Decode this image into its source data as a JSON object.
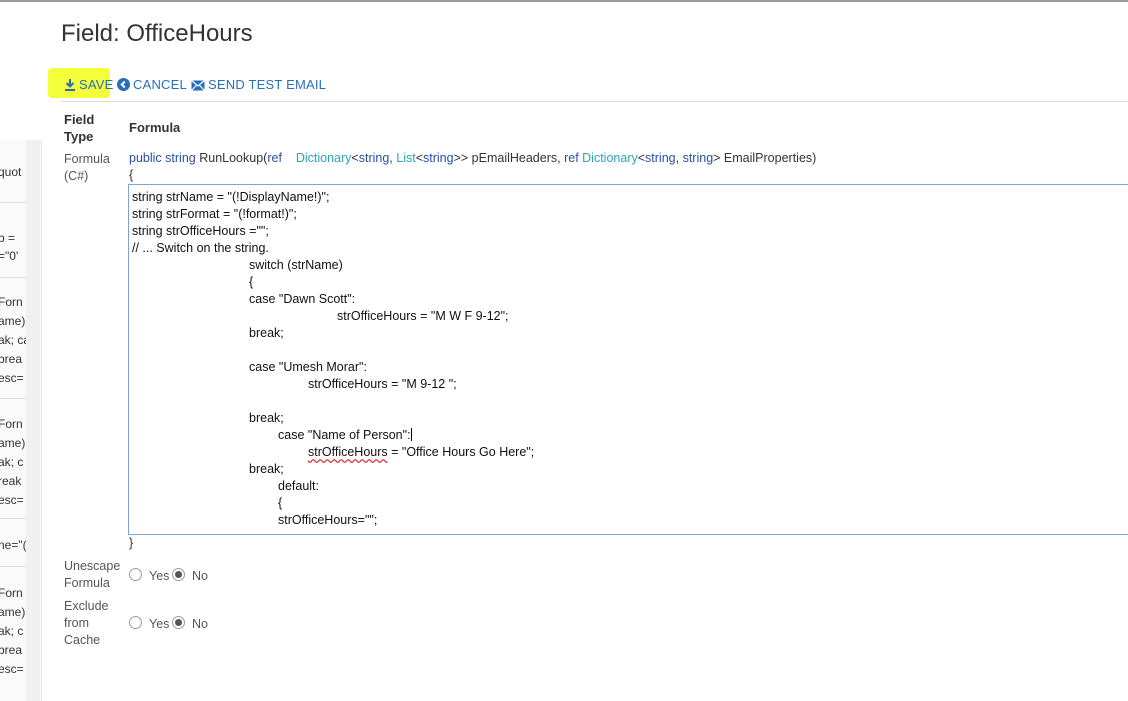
{
  "page": {
    "title": "Field: OfficeHours"
  },
  "toolbar": {
    "save": "SAVE",
    "cancel": "CANCEL",
    "send_test_email": "SEND TEST EMAIL"
  },
  "table": {
    "col_field_type": "Field Type",
    "col_formula": "Formula"
  },
  "row_formula": {
    "label": "Formula (C#)",
    "signature": {
      "t1": "public",
      "t2": "string",
      "t3": "RunLookup(",
      "t4": "ref",
      "t5": "Dictionary",
      "t6": "<",
      "t7": "string",
      "t8": ", ",
      "t9": "List",
      "t10": "<",
      "t11": "string",
      "t12": ">> pEmailHeaders, ",
      "t13": "ref",
      "t14": "Dictionary",
      "t15": "<",
      "t16": "string",
      "t17": ", ",
      "t18": "string",
      "t19": "> EmailProperties)"
    },
    "open_brace": "{",
    "close_brace": "}",
    "code_lines": [
      "string strName = \"(!DisplayName!)\";",
      "string strFormat = \"(!format!)\";",
      "string strOfficeHours =\"\";",
      "// ... Switch on the string.",
      "switch (strName)",
      "{",
      "case \"Dawn Scott\":",
      "strOfficeHours = \"M W F 9-12\";",
      "break;",
      "case \"Umesh Morar\":",
      "strOfficeHours = \"M 9-12 \";",
      "break;",
      "case \"Name of Person\":",
      "strOfficeHours",
      " = \"Office Hours Go Here\";",
      "break;",
      "default:",
      "{",
      "strOfficeHours=\"\";"
    ]
  },
  "row_unescape": {
    "label": "Unescape Formula",
    "yes": "Yes",
    "no": "No",
    "selected": "No"
  },
  "row_exclude": {
    "label": "Exclude from Cache",
    "yes": "Yes",
    "no": "No",
    "selected": "No"
  },
  "background_fragments": [
    "quot",
    "b =",
    "=\"0'",
    "Forn",
    "ame)",
    "ak; ca",
    "brea",
    "esc=",
    "Forn",
    "ame)",
    "ak; c",
    "reak",
    "esc=",
    "ne=\"(",
    "Forn",
    "ame)",
    "ak; c",
    "brea",
    "esc="
  ]
}
